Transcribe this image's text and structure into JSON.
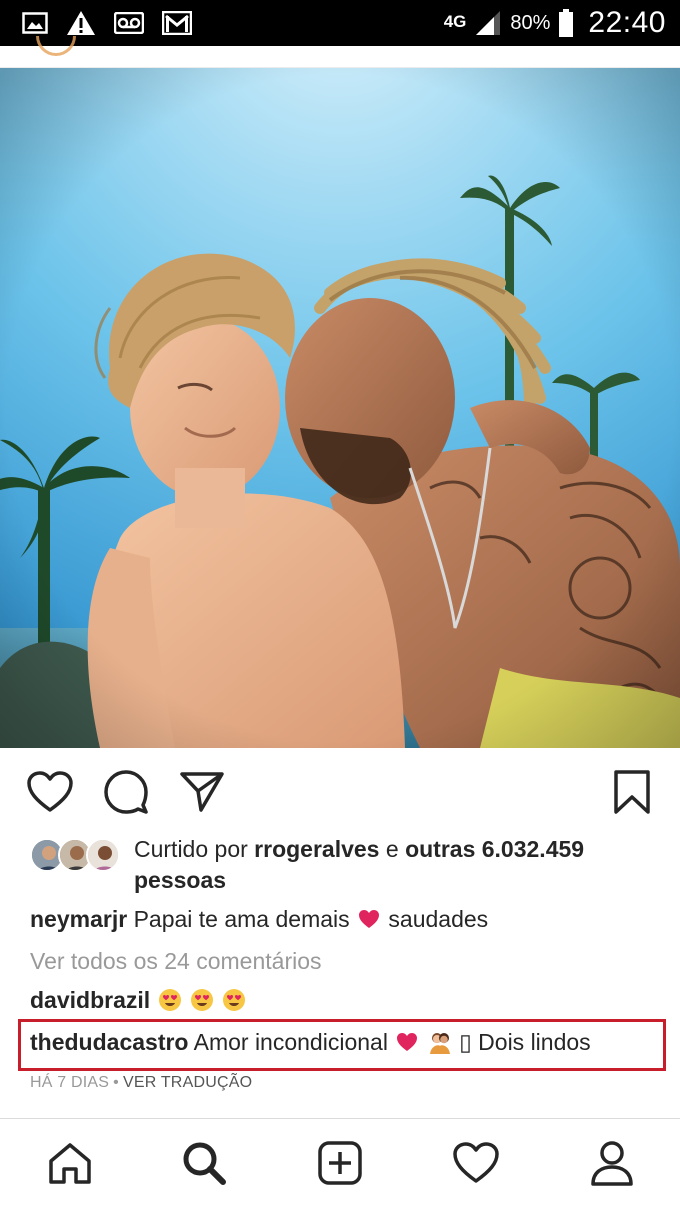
{
  "status_bar": {
    "network": "4G",
    "battery": "80%",
    "time": "22:40",
    "left_icons": [
      "gallery-icon",
      "warning-icon",
      "voicemail-icon",
      "gmail-icon"
    ]
  },
  "post": {
    "photo_alt": "",
    "actions": [
      "heart-icon",
      "comment-icon",
      "share-icon",
      "bookmark-icon"
    ],
    "likes": {
      "prefix": "Curtido por",
      "user": "rrogeralves",
      "conjunction": "e",
      "others": "outras 6.032.459 pessoas"
    },
    "caption": {
      "user": "neymarjr",
      "text_before": "Papai te ama demais",
      "text_after": "saudades"
    },
    "view_all_comments": "Ver todos os 24 comentários",
    "comments": [
      {
        "user": "davidbrazil",
        "text": ""
      },
      {
        "user": "thedudacastro",
        "text_before": "Amor incondicional",
        "missing_glyph": "▯",
        "text_after": "Dois lindos"
      }
    ],
    "timestamp": "HÁ 7 DIAS",
    "separator": "•",
    "translate": "VER TRADUÇÃO"
  },
  "bottom_nav": [
    "home-icon",
    "search-icon",
    "add-post-icon",
    "activity-heart-icon",
    "profile-icon"
  ],
  "colors": {
    "status_bar_bg": "#000000",
    "highlight_border": "#c81d2b",
    "secondary_text": "#999999",
    "heart_emoji": "#e0245e"
  }
}
